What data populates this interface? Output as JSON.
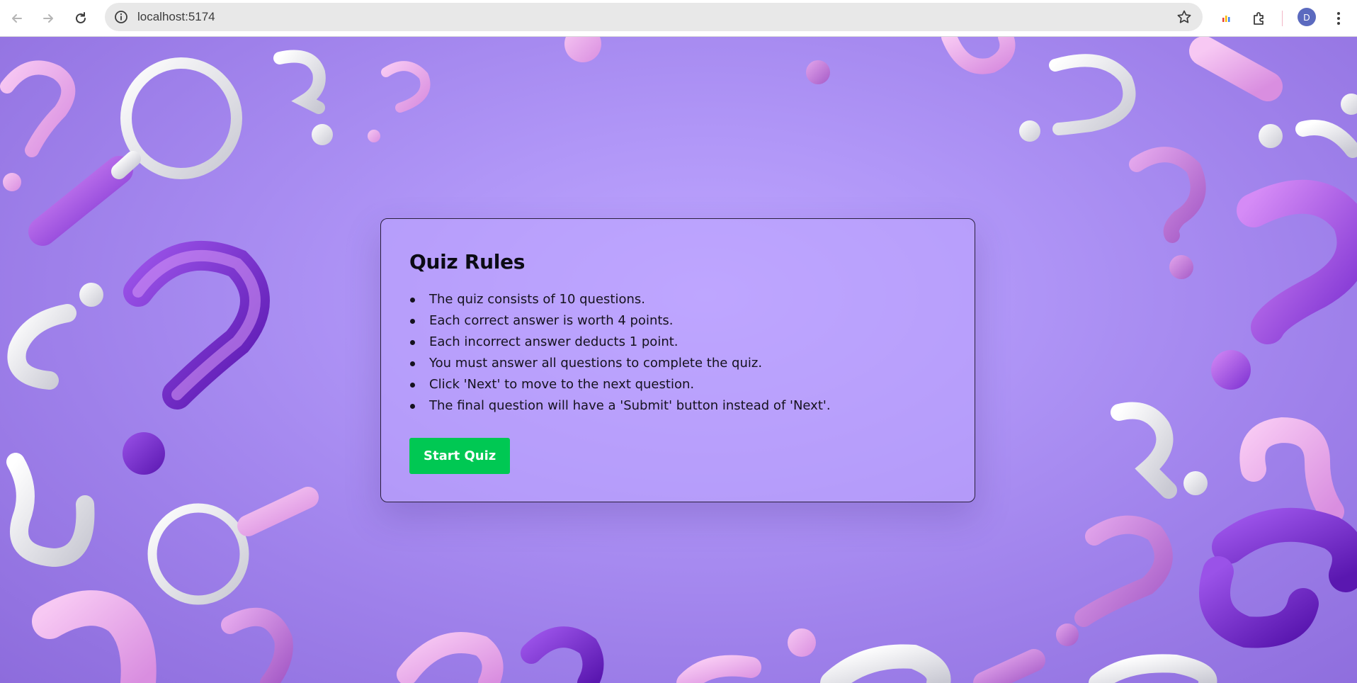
{
  "browser": {
    "url": "localhost:5174",
    "profile_initial": "D",
    "icons": {
      "back": "arrow-left-icon",
      "forward": "arrow-right-icon",
      "reload": "reload-icon",
      "site_info": "info-icon",
      "bookmark": "star-icon",
      "extension": "puzzle-icon",
      "menu": "kebab-menu-icon"
    }
  },
  "quiz": {
    "title": "Quiz Rules",
    "rules": [
      "The quiz consists of 10 questions.",
      "Each correct answer is worth 4 points.",
      "Each incorrect answer deducts 1 point.",
      "You must answer all questions to complete the quiz.",
      "Click 'Next' to move to the next question.",
      "The final question will have a 'Submit' button instead of 'Next'."
    ],
    "start_button_label": "Start Quiz"
  },
  "colors": {
    "background": "#a98cf2",
    "card_border": "#2a1f3d",
    "start_button": "#00c853",
    "profile_avatar": "#5b6abf"
  }
}
